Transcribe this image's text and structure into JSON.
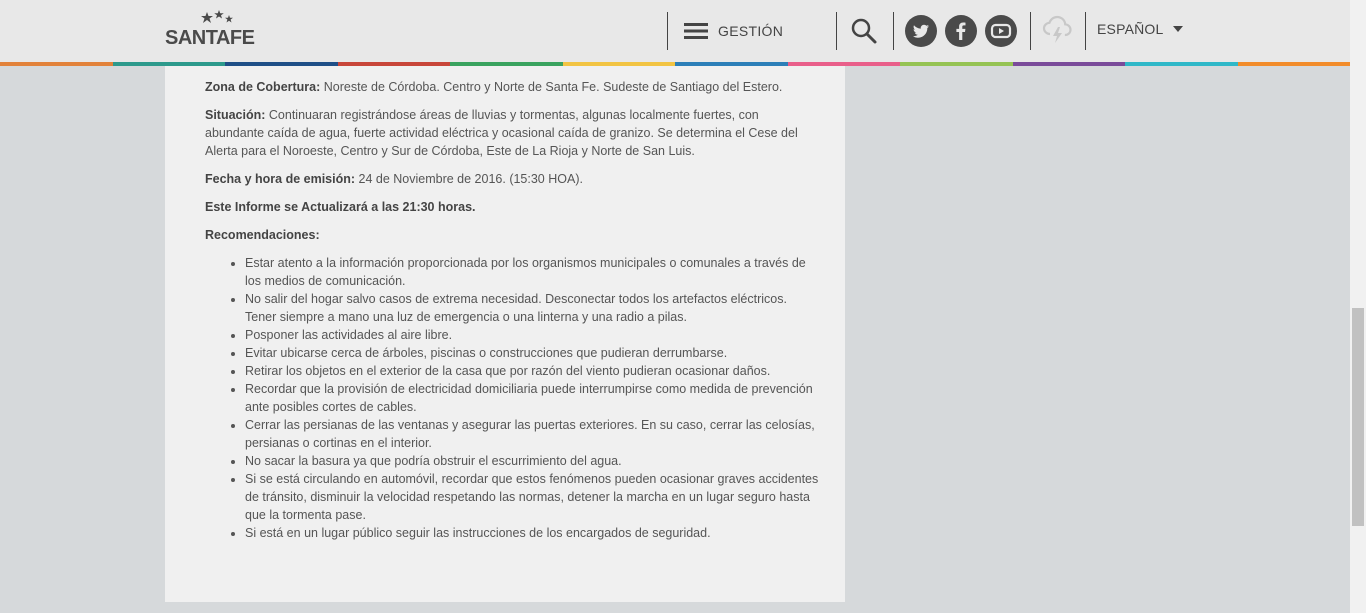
{
  "header": {
    "logo_text": "SANTAFE",
    "menu_label": "GESTIÓN",
    "language": "ESPAÑOL",
    "stripe_colors": [
      "#e2823a",
      "#2d9a8c",
      "#1f4f87",
      "#c8463a",
      "#3aa35f",
      "#f2c443",
      "#2c7fb8",
      "#e95f8a",
      "#95c353",
      "#7a4b9a",
      "#2fb8c8",
      "#f28c2a"
    ]
  },
  "content": {
    "zona_label": "Zona de Cobertura:",
    "zona_value": " Noreste de Córdoba. Centro y Norte de Santa Fe. Sudeste de Santiago del Estero.",
    "situacion_label": "Situación:",
    "situacion_value": " Continuaran registrándose áreas de lluvias y tormentas, algunas localmente fuertes, con abundante caída de agua, fuerte actividad eléctrica y ocasional caída de granizo. Se determina el Cese del Alerta para el Noroeste, Centro y Sur de Córdoba, Este de La Rioja y Norte de San Luis.",
    "fecha_label": "Fecha y hora de emisión:",
    "fecha_value": " 24 de Noviembre de 2016. (15:30 HOA).",
    "actualiza": "Este Informe se Actualizará a las 21:30 horas.",
    "recomendaciones_label": "Recomendaciones:",
    "recomendaciones": [
      "Estar atento a la información proporcionada por los organismos municipales o comunales a través de los medios de comunicación.",
      "No salir del hogar salvo casos de extrema necesidad. Desconectar todos los artefactos eléctricos. Tener siempre a mano una luz de emergencia o una linterna y una radio a pilas.",
      "Posponer las actividades al aire libre.",
      "Evitar ubicarse cerca de árboles, piscinas o construcciones que pudieran derrumbarse.",
      "Retirar los objetos en el exterior de la casa que por razón del viento pudieran ocasionar daños.",
      "Recordar que la provisión de electricidad domiciliaria puede interrumpirse como medida de prevención ante posibles cortes de cables.",
      "Cerrar las persianas de las ventanas y asegurar las puertas exteriores. En su caso, cerrar las celosías, persianas o cortinas en el interior.",
      "No sacar la basura ya que podría obstruir el escurrimiento del agua.",
      "Si se está circulando en automóvil, recordar que estos fenómenos pueden ocasionar graves accidentes de tránsito, disminuir la velocidad respetando las normas, detener la marcha en un lugar seguro hasta que la tormenta pase.",
      "Si está en un lugar público seguir las instrucciones de los encargados de seguridad."
    ]
  }
}
